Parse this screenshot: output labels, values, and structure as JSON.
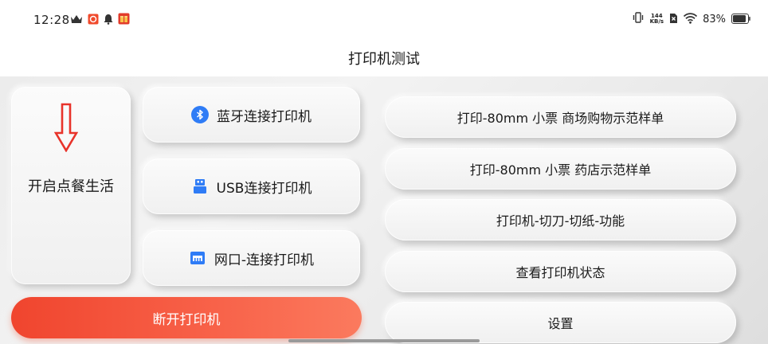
{
  "status_bar": {
    "time": "12:28",
    "net_speed_value": "144",
    "net_speed_unit": "KB/s",
    "battery": "83%",
    "icons": [
      "crown-icon",
      "app-badge-icon",
      "bell-icon",
      "gift-app-icon",
      "vibrate-icon",
      "sim-off-icon",
      "wifi-icon",
      "battery-icon"
    ]
  },
  "title": "打印机测试",
  "left_panel": {
    "label": "开启点餐生活",
    "arrow_icon": "arrow-down-icon",
    "arrow_color": "#e8332a"
  },
  "connect_buttons": [
    {
      "label": "蓝牙连接打印机",
      "icon": "bluetooth-icon"
    },
    {
      "label": "USB连接打印机",
      "icon": "usb-icon"
    },
    {
      "label": "网口-连接打印机",
      "icon": "ethernet-icon"
    }
  ],
  "disconnect_button": {
    "label": "断开打印机",
    "color": "#f0452e"
  },
  "actions": [
    {
      "label": "打印-80mm 小票 商场购物示范样单"
    },
    {
      "label": "打印-80mm 小票 药店示范样单"
    },
    {
      "label": "打印机-切刀-切纸-功能"
    },
    {
      "label": "查看打印机状态"
    },
    {
      "label": "设置"
    }
  ],
  "colors": {
    "accent_blue": "#2f7cf6",
    "brand_red": "#f0452e"
  }
}
